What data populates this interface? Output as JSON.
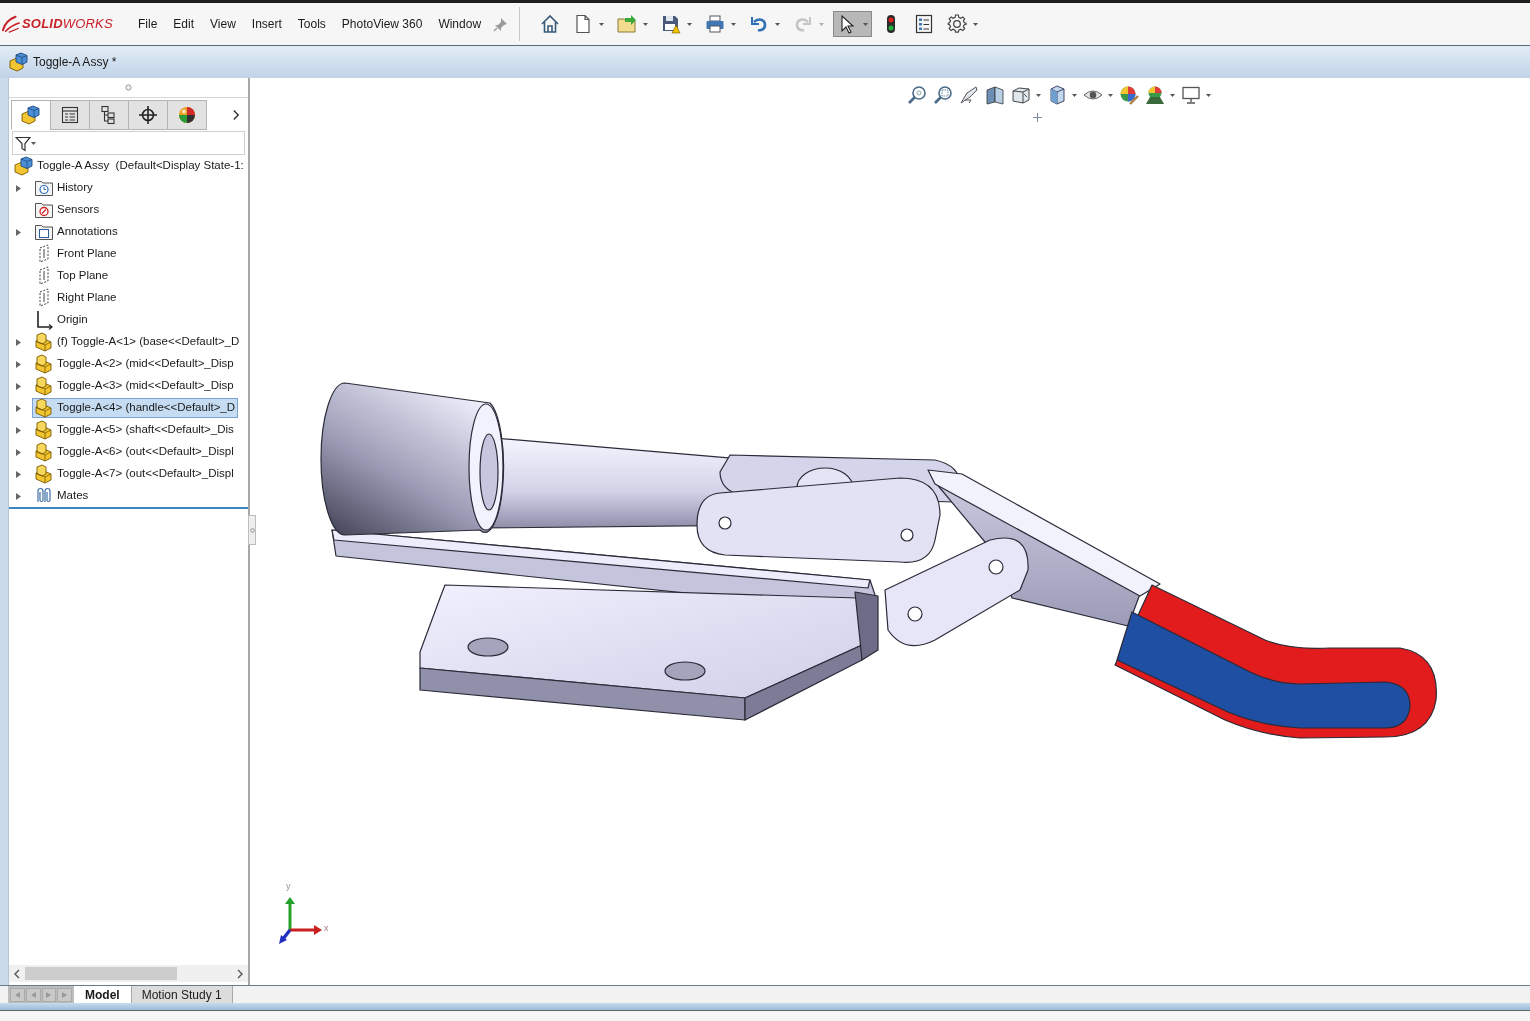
{
  "app": {
    "logo": "**SOLID**WORKS"
  },
  "menu": [
    "File",
    "Edit",
    "View",
    "Insert",
    "Tools",
    "PhotoView 360",
    "Window"
  ],
  "toolbar": [
    {
      "kind": "home",
      "dropdown": false,
      "disabled": false,
      "pressed": false
    },
    {
      "kind": "new",
      "dropdown": true,
      "disabled": false,
      "pressed": false
    },
    {
      "kind": "open",
      "dropdown": true,
      "disabled": false,
      "pressed": false
    },
    {
      "kind": "save",
      "dropdown": true,
      "disabled": false,
      "pressed": false
    },
    {
      "kind": "print",
      "dropdown": true,
      "disabled": false,
      "pressed": false
    },
    {
      "kind": "undo",
      "dropdown": true,
      "disabled": false,
      "pressed": false
    },
    {
      "kind": "redo",
      "dropdown": true,
      "disabled": true,
      "pressed": false
    },
    {
      "kind": "select",
      "dropdown": true,
      "disabled": false,
      "pressed": true
    },
    {
      "kind": "rebuild",
      "dropdown": false,
      "disabled": false,
      "pressed": false
    },
    {
      "kind": "properties",
      "dropdown": false,
      "disabled": false,
      "pressed": false
    },
    {
      "kind": "options",
      "dropdown": true,
      "disabled": false,
      "pressed": false
    }
  ],
  "document": {
    "title": "Toggle-A Assy *"
  },
  "feature_manager": {
    "tabs": [
      {
        "kind": "feature-tree",
        "selected": true
      },
      {
        "kind": "property",
        "selected": false
      },
      {
        "kind": "configuration",
        "selected": false
      },
      {
        "kind": "dimxpert",
        "selected": false
      },
      {
        "kind": "display",
        "selected": false
      }
    ],
    "tree": {
      "label": "Toggle-A Assy  (Default<Display State-1:",
      "kind": "assembly",
      "selected": false,
      "children": [
        {
          "label": "History",
          "kind": "history",
          "expandable": true,
          "selected": false
        },
        {
          "label": "Sensors",
          "kind": "sensors",
          "expandable": false,
          "selected": false
        },
        {
          "label": "Annotations",
          "kind": "annotations",
          "expandable": true,
          "selected": false
        },
        {
          "label": "Front Plane",
          "kind": "plane",
          "expandable": false,
          "selected": false
        },
        {
          "label": "Top Plane",
          "kind": "plane",
          "expandable": false,
          "selected": false
        },
        {
          "label": "Right Plane",
          "kind": "plane",
          "expandable": false,
          "selected": false
        },
        {
          "label": "Origin",
          "kind": "origin",
          "expandable": false,
          "selected": false
        },
        {
          "label": "(f) Toggle-A<1> (base<<Default>_D",
          "kind": "part",
          "expandable": true,
          "selected": false
        },
        {
          "label": "Toggle-A<2> (mid<<Default>_Disp",
          "kind": "part",
          "expandable": true,
          "selected": false
        },
        {
          "label": "Toggle-A<3> (mid<<Default>_Disp",
          "kind": "part",
          "expandable": true,
          "selected": false
        },
        {
          "label": "Toggle-A<4> (handle<<Default>_D",
          "kind": "part",
          "expandable": true,
          "selected": true
        },
        {
          "label": "Toggle-A<5> (shaft<<Default>_Dis",
          "kind": "part",
          "expandable": true,
          "selected": false
        },
        {
          "label": "Toggle-A<6> (out<<Default>_Displ",
          "kind": "part",
          "expandable": true,
          "selected": false
        },
        {
          "label": "Toggle-A<7> (out<<Default>_Displ",
          "kind": "part",
          "expandable": true,
          "selected": false
        },
        {
          "label": "Mates",
          "kind": "mates",
          "expandable": true,
          "selected": false
        }
      ]
    }
  },
  "bottom_tabs": [
    {
      "label": "Model",
      "selected": true
    },
    {
      "label": "Motion Study 1",
      "selected": false
    }
  ],
  "triad": {
    "x_label": "x",
    "y_label": "y"
  }
}
